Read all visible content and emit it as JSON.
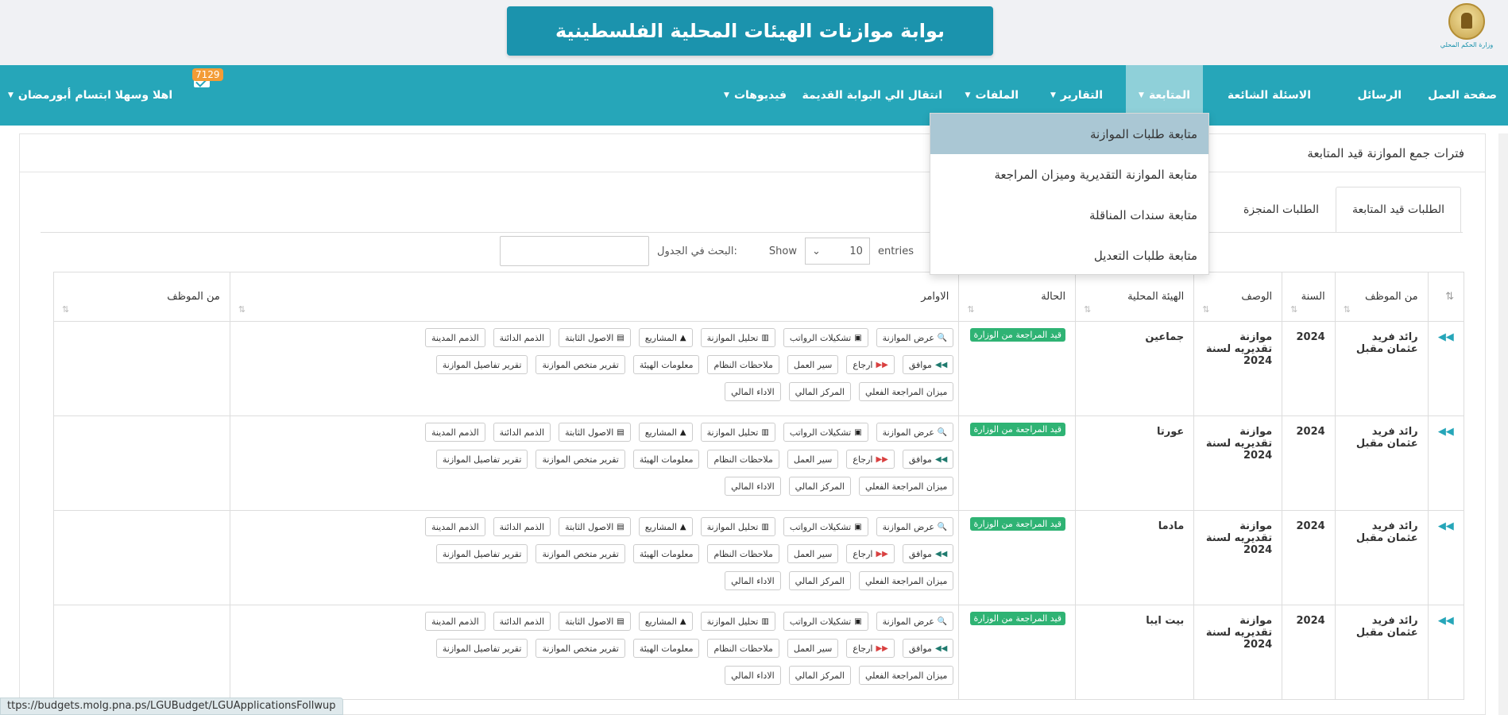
{
  "header": {
    "portal_title": "بوابة موازنات الهيئات المحلية الفلسطينية",
    "logo_text": "وزارة الحكم المحلي"
  },
  "nav": {
    "items": [
      {
        "label": "صفحة العمل",
        "has_caret": false
      },
      {
        "label": "الرسائل",
        "has_caret": false
      },
      {
        "label": "الاسئلة الشائعة",
        "has_caret": false
      },
      {
        "label": "المتابعة",
        "has_caret": true
      },
      {
        "label": "التقارير",
        "has_caret": true
      },
      {
        "label": "الملفات",
        "has_caret": true
      },
      {
        "label": "انتقال الي البوابة القديمة",
        "has_caret": false
      },
      {
        "label": "فيديوهات",
        "has_caret": true
      }
    ],
    "user_greeting": "اهلا وسهلا ابتسام أبورمضان",
    "mail_count": "7129"
  },
  "dropdown": {
    "items": [
      "متابعة طلبات الموازنة",
      "متابعة الموازنة التقديرية وميزان المراجعة",
      "متابعة سندات المناقلة",
      "متابعة طلبات التعديل"
    ]
  },
  "panel": {
    "title": "فترات جمع الموازنة قيد المتابعة"
  },
  "tabs": [
    "الطلبات قيد المتابعة",
    "الطلبات المنجزة"
  ],
  "controls": {
    "search_label": "البحث في الجدول:",
    "show_label": "Show",
    "length_value": "10",
    "entries_label": "entries"
  },
  "table": {
    "headers": [
      "",
      "من الموظف",
      "السنة",
      "الوصف",
      "الهيئة المحلية",
      "الحالة",
      "الاوامر",
      "من الموظف"
    ],
    "action_rows": [
      [
        "عرض الموازنة",
        "تشكيلات الرواتب",
        "تحليل الموازنة",
        "المشاريع",
        "الاصول الثابتة",
        "الذمم الدائنة",
        "الذمم المدينة"
      ],
      [
        "موافق",
        "ارجاع",
        "سير العمل",
        "ملاحظات النظام",
        "معلومات الهيئة",
        "تقرير متخص الموازنة",
        "تقرير تفاصيل الموازنة"
      ],
      [
        "ميزان المراجعة الفعلي",
        "المركز المالي",
        "الاداء المالي"
      ]
    ],
    "rows": [
      {
        "employee": "رائد فريد عثمان مقبل",
        "year": "2024",
        "description": "موازنة تقديريه لسنة 2024",
        "agency": "جماعين",
        "status": "قيد المراجعة من الوزارة"
      },
      {
        "employee": "رائد فريد عثمان مقبل",
        "year": "2024",
        "description": "موازنة تقديريه لسنة 2024",
        "agency": "عورتا",
        "status": "قيد المراجعة من الوزارة"
      },
      {
        "employee": "رائد فريد عثمان مقبل",
        "year": "2024",
        "description": "موازنة تقديريه لسنة 2024",
        "agency": "مادما",
        "status": "قيد المراجعة من الوزارة"
      },
      {
        "employee": "رائد فريد عثمان مقبل",
        "year": "2024",
        "description": "موازنة تقديريه لسنة 2024",
        "agency": "بيت ايبا",
        "status": "قيد المراجعة من الوزارة"
      }
    ]
  },
  "status_bar": {
    "url": "ttps://budgets.molg.pna.ps/LGUBudget/LGUApplicationsFollwup"
  },
  "colors": {
    "navbar": "#26a6b9",
    "title_banner": "#1b93ad",
    "status_badge": "#2fb374",
    "mail_badge": "#f39c36",
    "dropdown_selected": "#aac7d4"
  }
}
